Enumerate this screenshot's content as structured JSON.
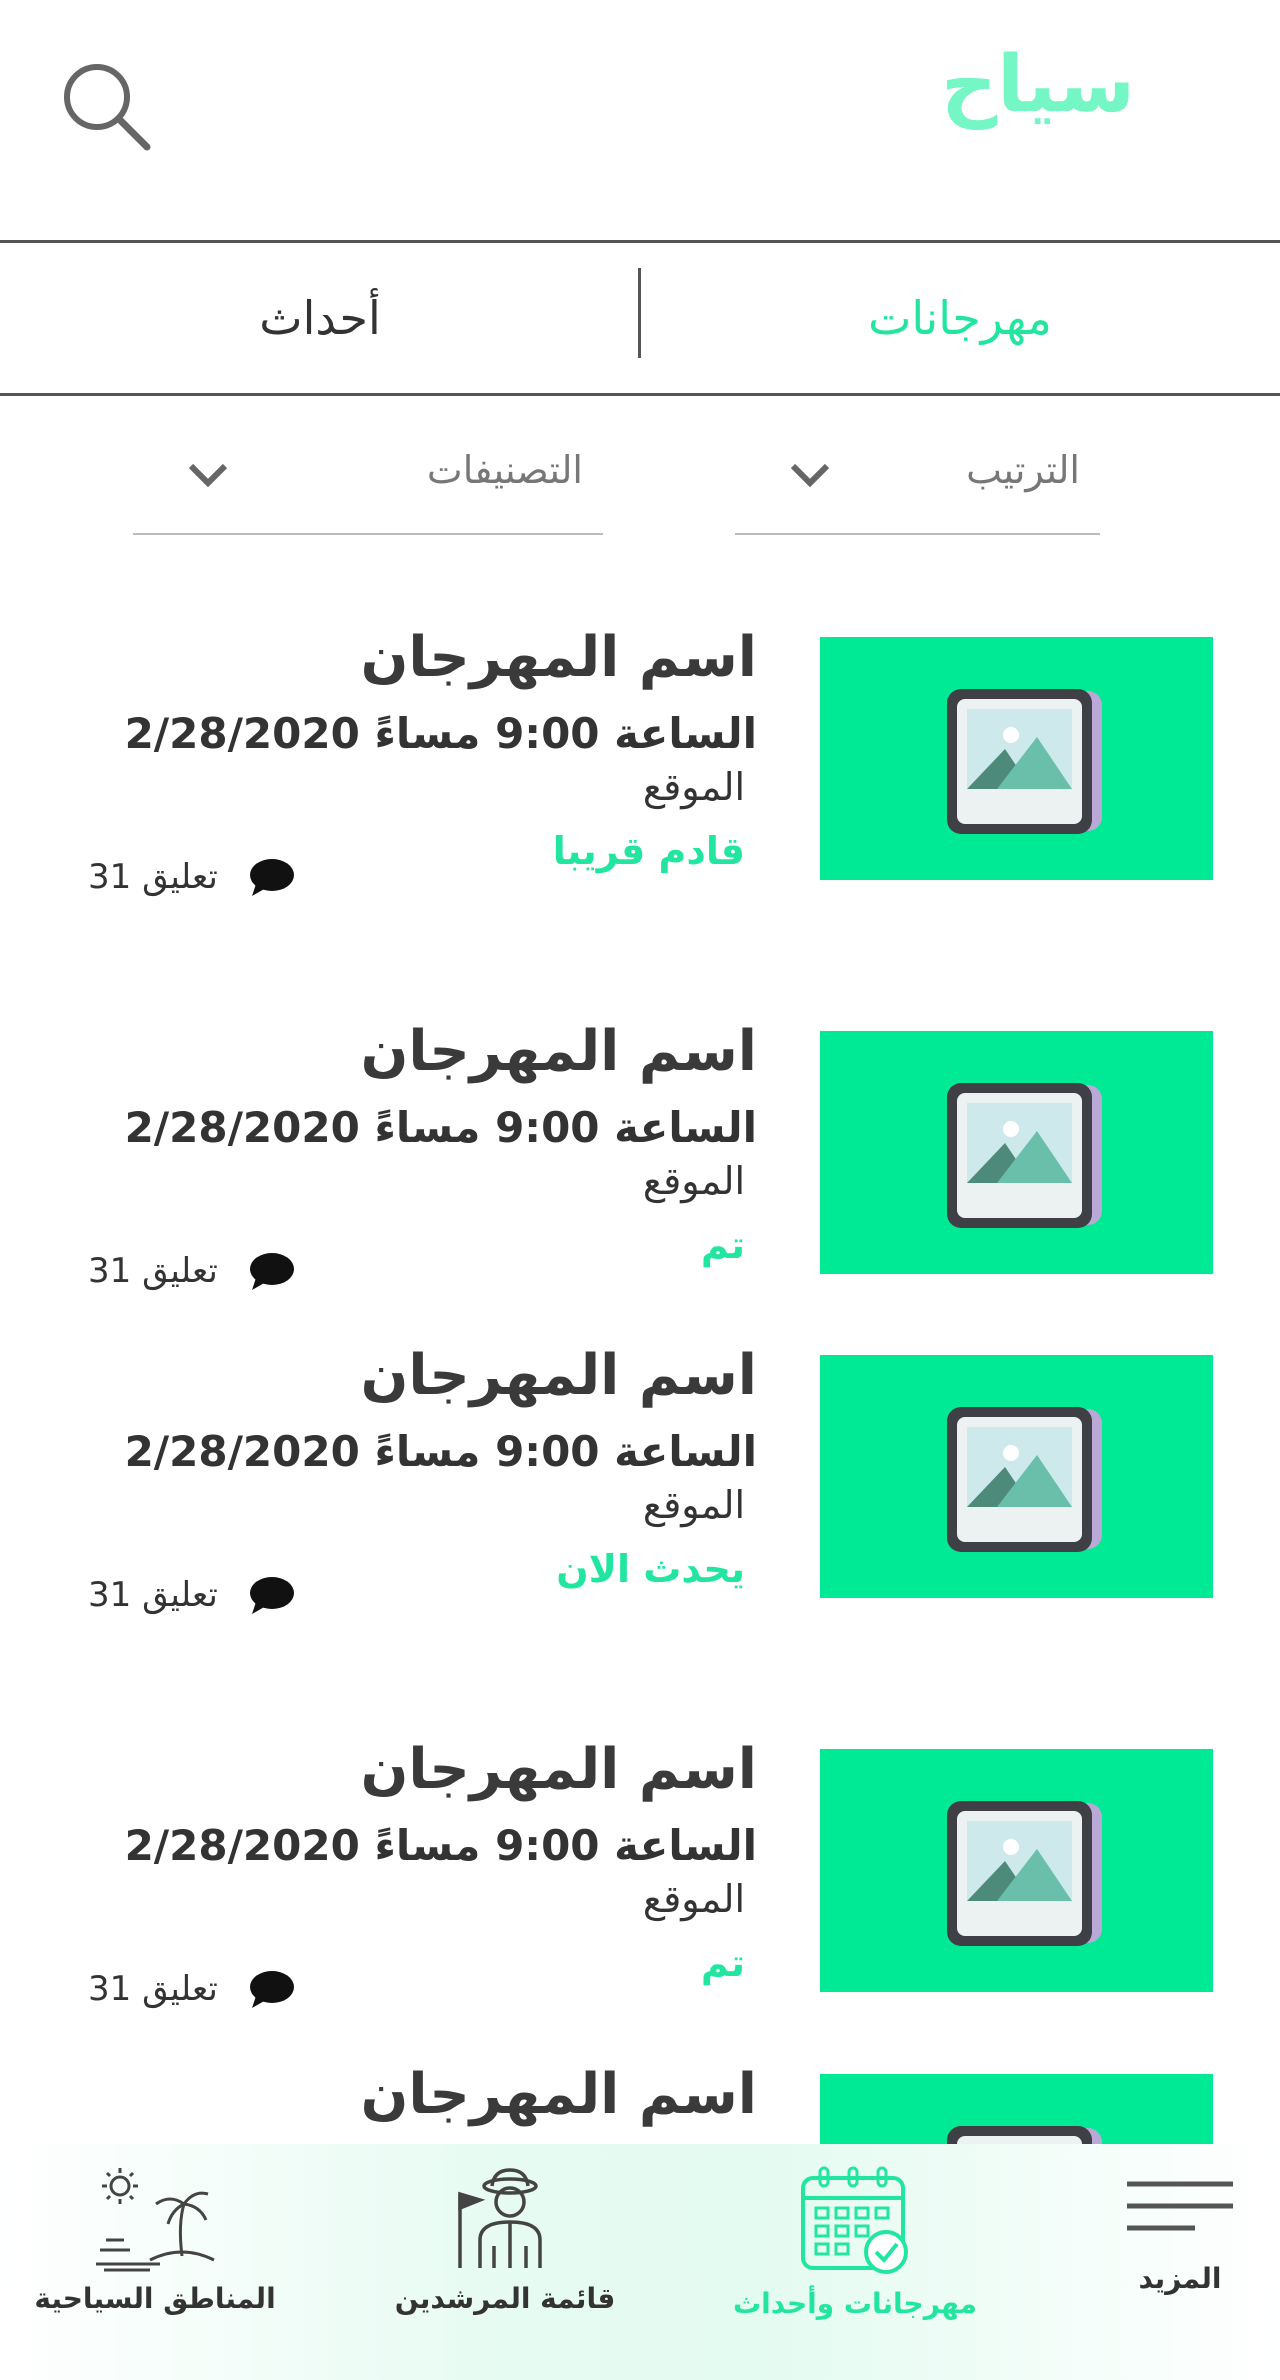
{
  "app": {
    "logo": "سياح",
    "accent_color": "#22e6a0",
    "logo_color": "#74f7c4",
    "image_placeholder_color": "#00ea95"
  },
  "header": {
    "search_icon": "search-icon"
  },
  "tabs": [
    {
      "label": "مهرجانات",
      "active": true
    },
    {
      "label": "أحداث",
      "active": false
    }
  ],
  "filters": {
    "sort": {
      "label": "الترتيب",
      "icon": "chevron-down-icon"
    },
    "categories": {
      "label": "التصنيفات",
      "icon": "chevron-down-icon"
    }
  },
  "cards": [
    {
      "title": "اسم المهرجان",
      "time": "الساعة 9:00 مساءً 2/28/2020",
      "location": "الموقع",
      "status": "قادم قريبا",
      "comments": "تعليق 31",
      "image_icon": "image-placeholder-icon"
    },
    {
      "title": "اسم المهرجان",
      "time": "الساعة 9:00 مساءً 2/28/2020",
      "location": "الموقع",
      "status": "تم",
      "comments": "تعليق 31",
      "image_icon": "image-placeholder-icon"
    },
    {
      "title": "اسم المهرجان",
      "time": "الساعة 9:00 مساءً 2/28/2020",
      "location": "الموقع",
      "status": "يحدث الان",
      "comments": "تعليق 31",
      "image_icon": "image-placeholder-icon"
    },
    {
      "title": "اسم المهرجان",
      "time": "الساعة 9:00 مساءً 2/28/2020",
      "location": "الموقع",
      "status": "تم",
      "comments": "تعليق 31",
      "image_icon": "image-placeholder-icon"
    },
    {
      "title": "اسم المهرجان",
      "image_icon": "image-placeholder-icon"
    }
  ],
  "bottom_nav": [
    {
      "label": "المزيد",
      "icon": "menu-icon",
      "active": false
    },
    {
      "label": "مهرجانات وأحداث",
      "icon": "calendar-check-icon",
      "active": true
    },
    {
      "label": "قائمة المرشدين",
      "icon": "tour-guide-icon",
      "active": false
    },
    {
      "label": "المناطق السياحية",
      "icon": "beach-island-icon",
      "active": false
    }
  ]
}
